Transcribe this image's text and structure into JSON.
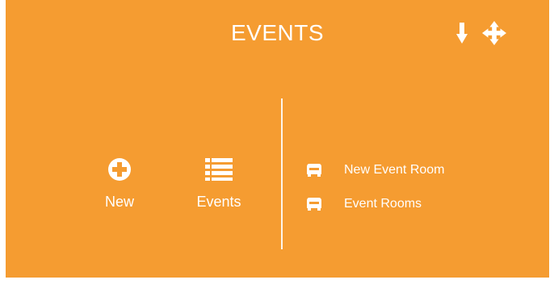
{
  "tile": {
    "title": "EVENTS",
    "background": "#f59c31",
    "header_icons": [
      "arrow-down-icon",
      "move-icon"
    ]
  },
  "actions": [
    {
      "label": "New",
      "icon": "plus-circle-icon"
    },
    {
      "label": "Events",
      "icon": "list-icon"
    }
  ],
  "links": [
    {
      "label": "New Event Room",
      "icon": "armchair-icon"
    },
    {
      "label": "Event Rooms",
      "icon": "armchair-icon"
    }
  ]
}
